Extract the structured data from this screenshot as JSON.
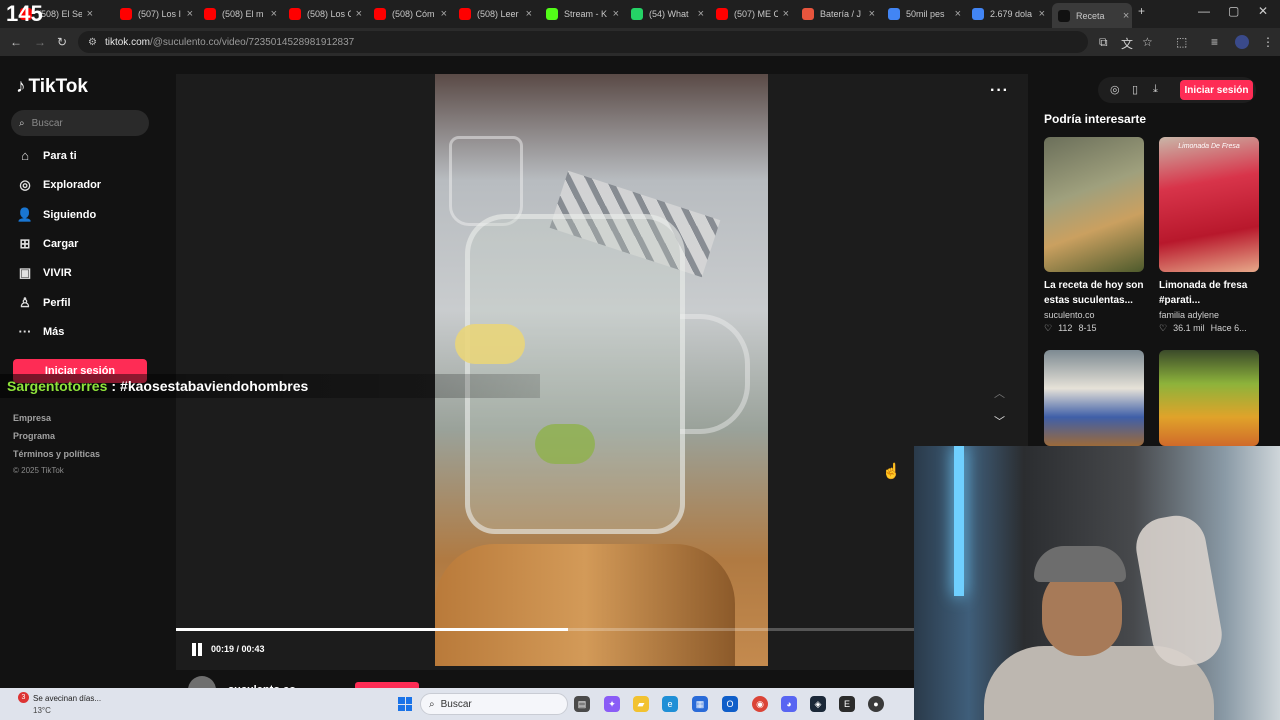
{
  "browser": {
    "tab_count": "145",
    "tabs": [
      {
        "title": "(508) El Se",
        "icon": "youtube-icon",
        "color": "#ff0000"
      },
      {
        "title": "(507) Los I",
        "icon": "youtube-icon",
        "color": "#ff0000"
      },
      {
        "title": "(508) El m",
        "icon": "youtube-icon",
        "color": "#ff0000"
      },
      {
        "title": "(508) Los C",
        "icon": "youtube-icon",
        "color": "#ff0000"
      },
      {
        "title": "(508) Cóm",
        "icon": "youtube-icon",
        "color": "#ff0000"
      },
      {
        "title": "(508) Leer",
        "icon": "youtube-icon",
        "color": "#ff0000"
      },
      {
        "title": "Stream - K",
        "icon": "kick-icon",
        "color": "#53fc18"
      },
      {
        "title": "(54) What",
        "icon": "whatsapp-icon",
        "color": "#25d366"
      },
      {
        "title": "(507) ME C",
        "icon": "youtube-icon",
        "color": "#ff0000"
      },
      {
        "title": "Batería / J",
        "icon": "k-site-icon",
        "color": "#e8553d"
      },
      {
        "title": "50mil pes",
        "icon": "google-icon",
        "color": "#4285f4"
      },
      {
        "title": "2.679 dola",
        "icon": "google-icon",
        "color": "#4285f4"
      },
      {
        "title": "Receta",
        "icon": "tiktok-icon",
        "color": "#111111",
        "active": true
      }
    ],
    "new_tab": "+",
    "window_controls": {
      "minimize": "—",
      "maximize": "▢",
      "close": "✕"
    },
    "url_host": "tiktok.com",
    "url_path": "/@suculento.co/video/7235014528981912837"
  },
  "sidebar": {
    "logo": "TikTok",
    "search_placeholder": "Buscar",
    "nav": [
      {
        "label": "Para ti",
        "icon": "home-icon",
        "glyph": "⌂"
      },
      {
        "label": "Explorador",
        "icon": "compass-icon",
        "glyph": "◎"
      },
      {
        "label": "Siguiendo",
        "icon": "following-icon",
        "glyph": "👤"
      },
      {
        "label": "Cargar",
        "icon": "upload-icon",
        "glyph": "⊞"
      },
      {
        "label": "VIVIR",
        "icon": "live-icon",
        "glyph": "▣"
      },
      {
        "label": "Perfil",
        "icon": "profile-icon",
        "glyph": "♙"
      },
      {
        "label": "Más",
        "icon": "more-icon",
        "glyph": "···"
      }
    ],
    "login_button": "Iniciar sesión",
    "footer_links": [
      "Empresa",
      "Programa",
      "Términos y políticas"
    ],
    "copyright": "© 2025 TikTok"
  },
  "player": {
    "more_menu": "···",
    "current_time": "00:19",
    "duration": "00:43",
    "time_display": "00:19 / 00:43",
    "progress_fraction": 0.53,
    "author": "suculento.co"
  },
  "header_actions": {
    "login_button": "Iniciar sesión"
  },
  "recommendations": {
    "title": "Podría interesarte",
    "cards": [
      {
        "title": "La receta de hoy son estas suculentas...",
        "author": "suculento.co",
        "likes": "112",
        "date": "8-15"
      },
      {
        "title": "Limonada de fresa #parati...",
        "author": "familia adylene",
        "likes": "36.1 mil",
        "date": "Hace 6...",
        "overlay_text": "Limonada De Fresa"
      },
      {
        "title": "",
        "author": "",
        "likes": "",
        "date": ""
      },
      {
        "title": "",
        "author": "",
        "likes": "",
        "date": ""
      }
    ]
  },
  "chat": {
    "user": "Sargentotorres",
    "separator": ":",
    "message": "#kaosestabaviendohombres"
  },
  "taskbar": {
    "weather_text": "Se avecinan días...",
    "weather_temp": "13°C",
    "weather_badge": "3",
    "search_placeholder": "Buscar"
  }
}
